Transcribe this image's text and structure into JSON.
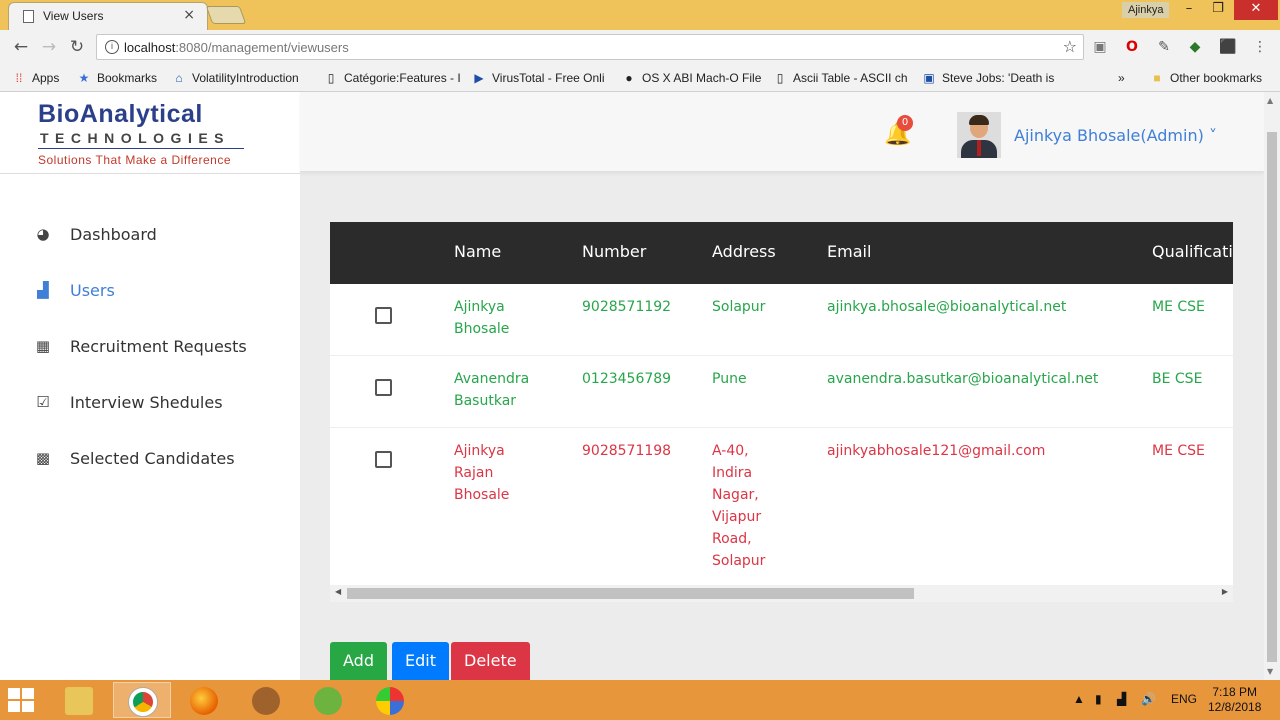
{
  "browser": {
    "tab_title": "View Users",
    "user_chip": "Ajinkya",
    "url_host": "localhost",
    "url_path": ":8080/management/viewusers",
    "bookmarks": [
      {
        "label": "Apps",
        "icon": "apps-grid-icon"
      },
      {
        "label": "Bookmarks",
        "icon": "star-icon"
      },
      {
        "label": "VolatilityIntroduction",
        "icon": "page-icon"
      },
      {
        "label": "Catégorie:Features - I",
        "icon": "document-icon"
      },
      {
        "label": "VirusTotal - Free Onli",
        "icon": "virustotal-icon"
      },
      {
        "label": "OS X ABI Mach-O File",
        "icon": "apple-icon"
      },
      {
        "label": "Ascii Table - ASCII ch",
        "icon": "document-icon"
      },
      {
        "label": "Steve Jobs: 'Death is",
        "icon": "g-icon"
      },
      {
        "label": "Other bookmarks",
        "icon": "folder-icon"
      }
    ],
    "more": "»"
  },
  "logo": {
    "main": "BioAnalytical",
    "sub": "TECHNOLOGIES",
    "tag": "Solutions That Make a Difference"
  },
  "sidebar": {
    "items": [
      {
        "label": "Dashboard",
        "icon": "dashboard-gauge-icon",
        "active": false
      },
      {
        "label": "Users",
        "icon": "bar-chart-icon",
        "active": true
      },
      {
        "label": "Recruitment Requests",
        "icon": "table-icon",
        "active": false
      },
      {
        "label": "Interview Shedules",
        "icon": "checkbox-icon",
        "active": false
      },
      {
        "label": "Selected Candidates",
        "icon": "calendar-icon",
        "active": false
      }
    ]
  },
  "header": {
    "notification_count": "0",
    "username": "Ajinkya Bhosale(Admin)",
    "caret": "˅"
  },
  "table": {
    "columns": [
      "Name",
      "Number",
      "Address",
      "Email",
      "Qualificati"
    ],
    "rows": [
      {
        "name": "Ajinkya\nBhosale",
        "number": "9028571192",
        "address": "Solapur",
        "email": "ajinkya.bhosale@bioanalytical.net",
        "qualification": "ME CSE",
        "status": "green"
      },
      {
        "name": "Avanendra\nBasutkar",
        "number": "0123456789",
        "address": "Pune",
        "email": "avanendra.basutkar@bioanalytical.net",
        "qualification": "BE CSE",
        "status": "green"
      },
      {
        "name": "Ajinkya\nRajan\nBhosale",
        "number": "9028571198",
        "address": "A-40,\nIndira\nNagar,\nVijapur\nRoad,\nSolapur",
        "email": "ajinkyabhosale121@gmail.com",
        "qualification": "ME CSE",
        "status": "red"
      }
    ]
  },
  "actions": {
    "add": "Add",
    "edit": "Edit",
    "delete": "Delete"
  },
  "taskbar": {
    "lang": "ENG",
    "time": "7:18 PM",
    "date": "12/8/2018"
  },
  "colors": {
    "accent": "#3f7fd6",
    "success": "#28a745",
    "primary": "#007bff",
    "danger": "#dc3545",
    "table_header": "#2b2b2b"
  }
}
